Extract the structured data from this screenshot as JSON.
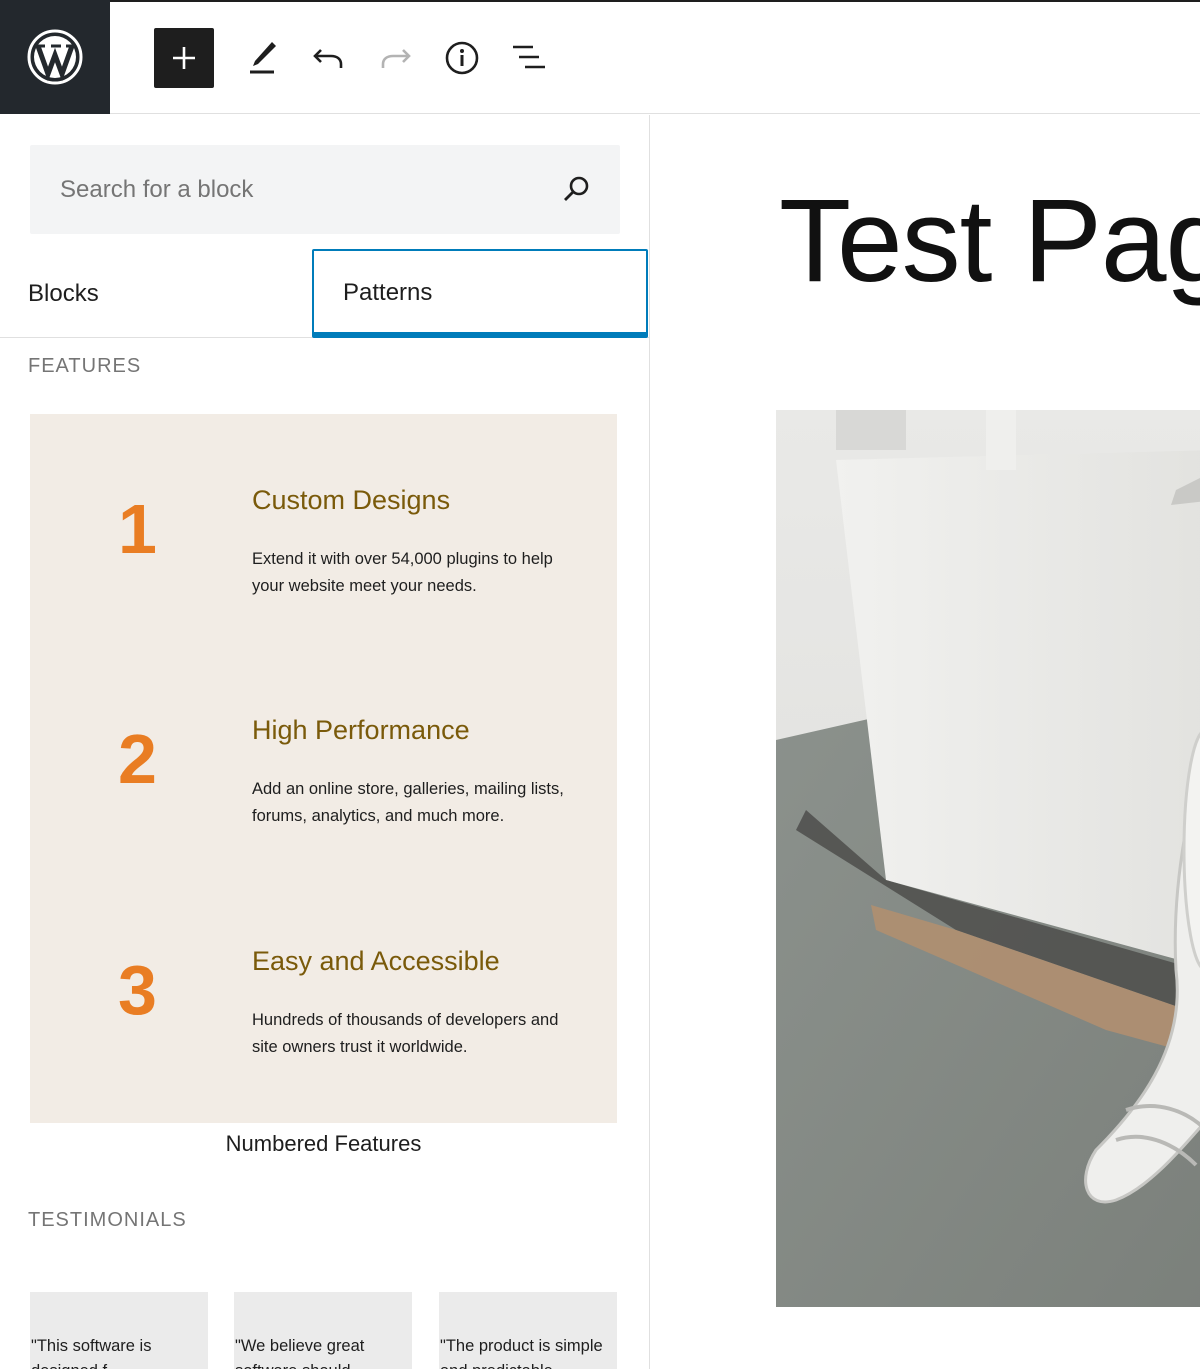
{
  "toolbar": {
    "items": [
      "wordpress-logo",
      "add-block",
      "edit-tool",
      "undo",
      "redo",
      "details",
      "list-view"
    ],
    "colors": {
      "dark": "#1e1e1e",
      "logo_bg": "#23282d",
      "redo_disabled": "#b3b3b3"
    }
  },
  "inserter": {
    "search": {
      "placeholder": "Search for a block",
      "value": ""
    },
    "tabs": [
      {
        "label": "Blocks",
        "active": false
      },
      {
        "label": "Patterns",
        "active": true
      }
    ],
    "categories": {
      "features": "FEATURES",
      "testimonials": "TESTIMONIALS"
    },
    "numbered_features": {
      "title": "Numbered Features",
      "items": [
        {
          "number": "1",
          "title": "Custom Designs",
          "desc_lines": [
            "Extend it with over 54,000 plugins to help",
            "your website meet your needs."
          ]
        },
        {
          "number": "2",
          "title": "High Performance",
          "desc_lines": [
            "Add an online store, galleries, mailing lists,",
            "forums, analytics, and much more."
          ]
        },
        {
          "number": "3",
          "title": "Easy and Accessible",
          "desc_lines": [
            "Hundreds of thousands of developers and",
            "site owners trust it worldwide."
          ]
        }
      ]
    },
    "testimonials": [
      {
        "line1": "\"This software is",
        "line2": "designed f..."
      },
      {
        "line1": "\"We believe great",
        "line2": "software should..."
      },
      {
        "line1": "\"The product is simple",
        "line2": "and predictable..."
      }
    ],
    "colors": {
      "accent": "#007cba",
      "preview_bg": "#f2ece5",
      "number": "#e97d23",
      "feature_title": "#7a5a0a"
    }
  },
  "canvas": {
    "page_title": "Test Pag"
  }
}
